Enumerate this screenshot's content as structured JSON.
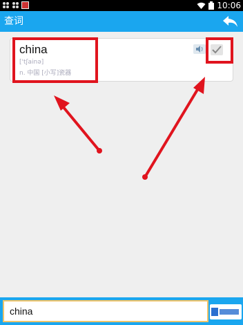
{
  "status_bar": {
    "time": "10:06",
    "icons": [
      "notification-icon",
      "notification-icon",
      "app-icon",
      "wifi-icon",
      "battery-icon"
    ]
  },
  "app_bar": {
    "title": "查词",
    "back_icon": "back-arrow-icon"
  },
  "result": {
    "word": "china",
    "phonetic": "['tʃainə]",
    "definition": "n. 中国   [小写]瓷器",
    "speaker_icon": "speaker-icon",
    "check_icon": "check-icon"
  },
  "annotations": {
    "color": "#e0141e"
  },
  "search": {
    "value": "china"
  },
  "colors": {
    "accent": "#1aa6ef",
    "input_border": "#f0c46a",
    "background": "#efefef"
  }
}
